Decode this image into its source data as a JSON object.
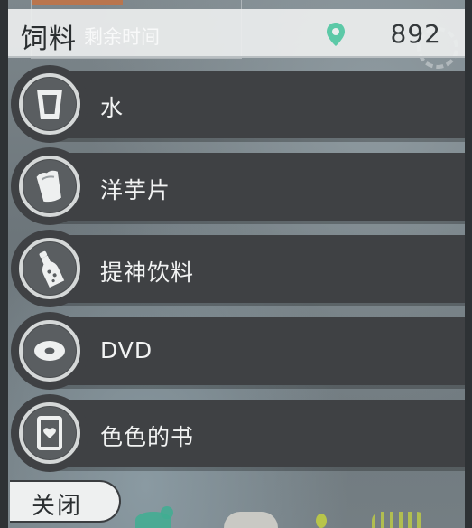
{
  "header": {
    "title": "饲料",
    "ghost_text": "剩余时间",
    "count": "892",
    "icon": "map-pin-icon"
  },
  "items": [
    {
      "label": "水",
      "icon": "water-cup-icon"
    },
    {
      "label": "洋芋片",
      "icon": "chips-bag-icon"
    },
    {
      "label": "提神饮料",
      "icon": "bottle-icon"
    },
    {
      "label": "DVD",
      "icon": "dvd-disc-icon"
    },
    {
      "label": "色色的书",
      "icon": "heart-book-icon"
    }
  ],
  "footer": {
    "close_label": "关闭"
  },
  "colors": {
    "row_bg": "#3f4144",
    "pin_accent": "#5cc9a7",
    "header_bg": "#eceeee"
  }
}
